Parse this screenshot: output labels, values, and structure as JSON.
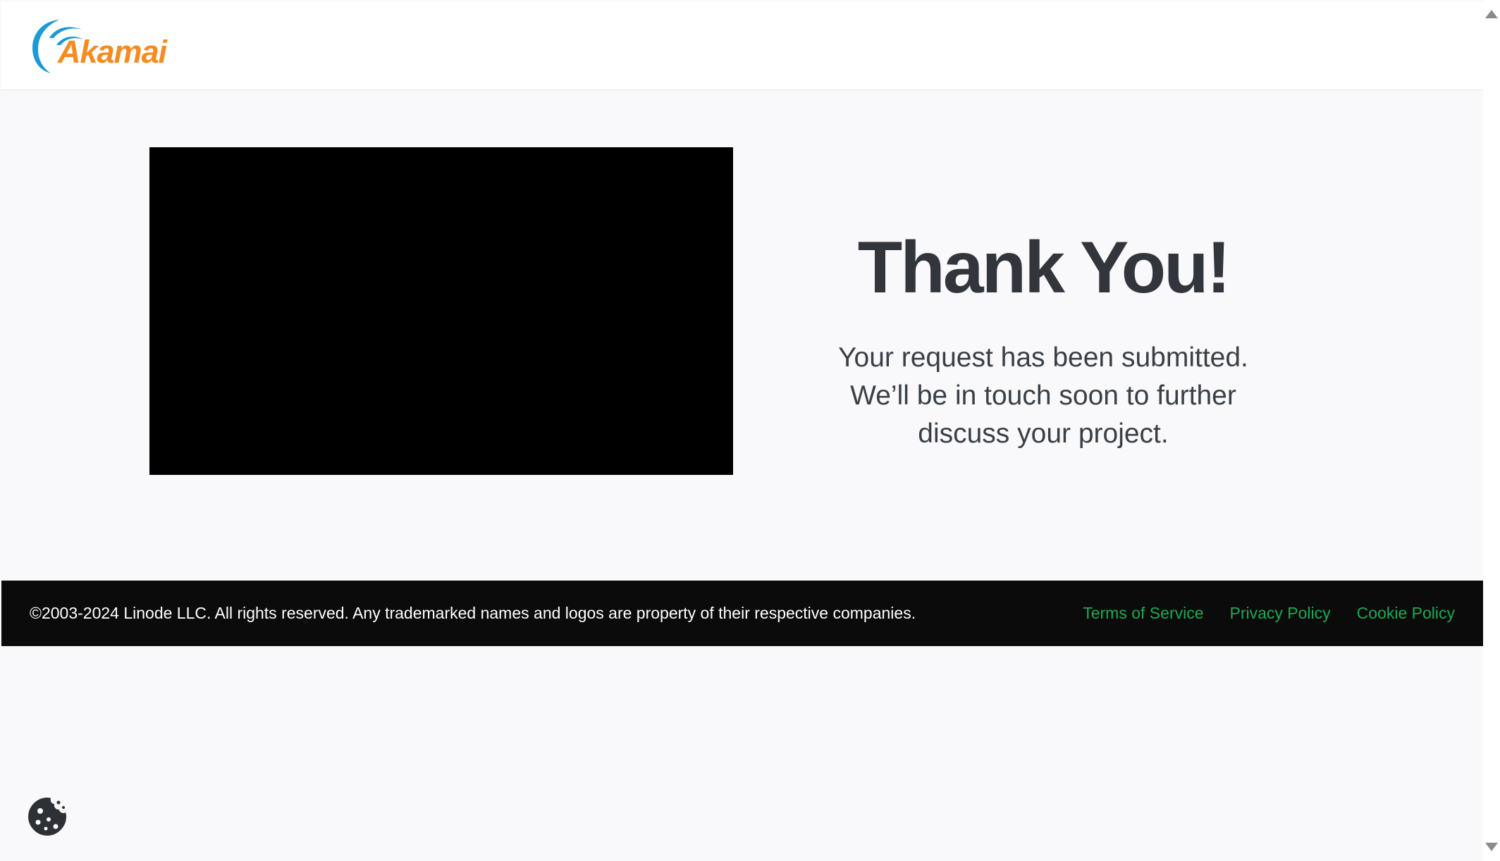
{
  "header": {
    "logo": {
      "icon": "akamai-wave-logo",
      "text": "Akamai",
      "color": "#f68b1f",
      "wave_color": "#1a9ad6"
    }
  },
  "main": {
    "media_color": "#000000",
    "title": "Thank You!",
    "message": "Your request has been submitted. We’ll be in touch soon to further discuss your project."
  },
  "footer": {
    "copyright": "©2003-2024 Linode LLC. All rights reserved. Any trademarked names and logos are property of their respective companies.",
    "links": [
      {
        "label": "Terms of Service"
      },
      {
        "label": "Privacy Policy"
      },
      {
        "label": "Cookie Policy"
      }
    ],
    "link_color": "#1ea952"
  },
  "cookie_button": {
    "icon": "cookie-icon"
  },
  "scrollbar": {
    "icons": [
      "scroll-up-arrow-icon",
      "scroll-down-arrow-icon"
    ]
  }
}
